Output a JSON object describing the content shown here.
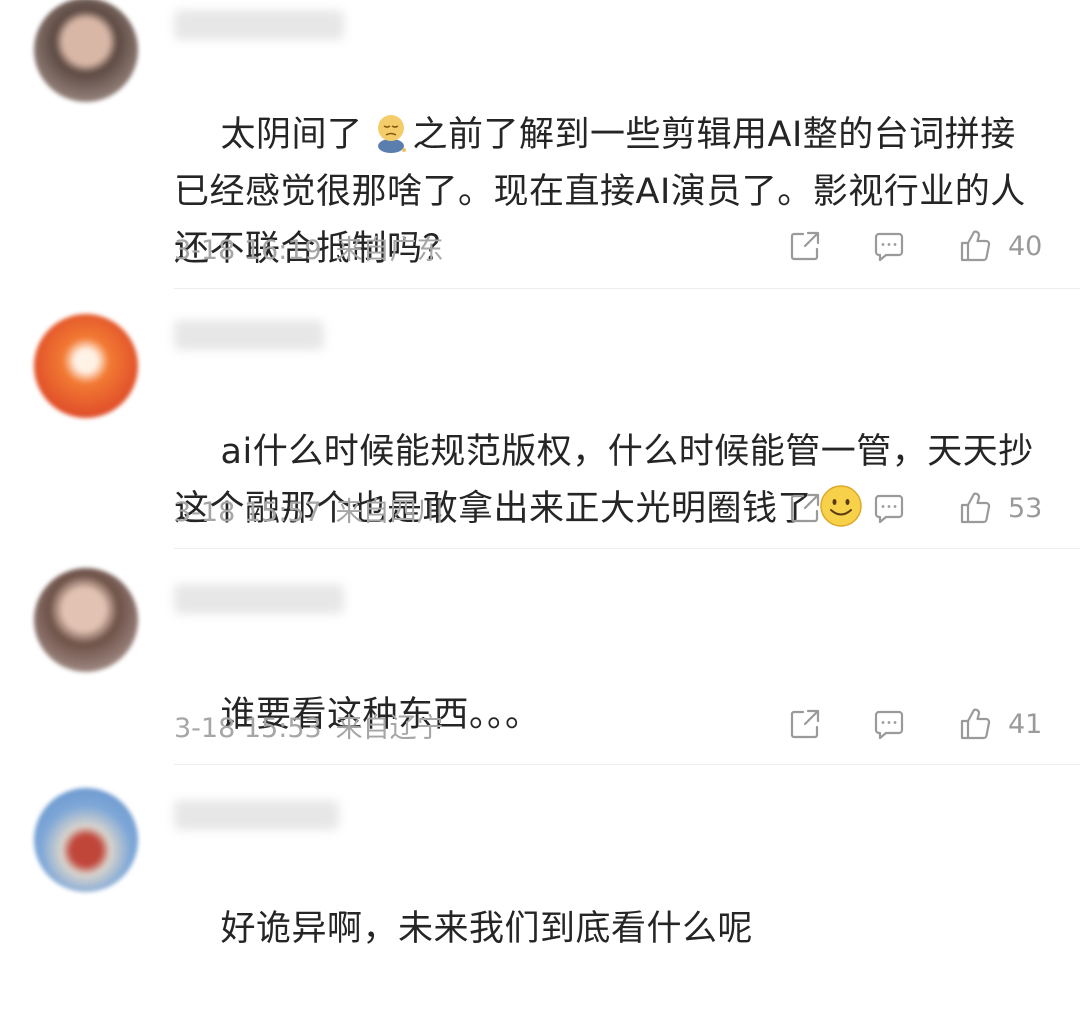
{
  "comments": [
    {
      "text_before_emoji": "太阴间了",
      "emoji": "sad-face-emoji",
      "text_after_emoji": "之前了解到一些剪辑用AI整的台词拼接已经感觉很那啥了。现在直接AI演员了。影视行业的人还不联合抵制吗？",
      "date": "3-18 16:19",
      "location": "来自广东",
      "likes": "40"
    },
    {
      "text_before_emoji": "ai什么时候能规范版权，什么时候能管一管，天天抄这个融那个也是敢拿出来正大光明圈钱了",
      "emoji": "smile-face-emoji",
      "text_after_emoji": "",
      "date": "3-18 15:57",
      "location": "来自四川",
      "likes": "53"
    },
    {
      "text_before_emoji": "谁要看这种东西。。。",
      "emoji": "",
      "text_after_emoji": "",
      "date": "3-18 15:53",
      "location": "来自辽宁",
      "likes": "41"
    },
    {
      "text_before_emoji": "好诡异啊，未来我们到底看什么呢",
      "emoji": "",
      "text_after_emoji": "",
      "date": "",
      "location": "",
      "likes": ""
    }
  ],
  "icons": {
    "share": "share-icon",
    "comment": "comment-icon",
    "like": "thumbs-up-icon"
  },
  "colors": {
    "text": "#252525",
    "meta": "#a6a6a6",
    "icon": "#9a9a9a",
    "divider": "#ededed"
  }
}
